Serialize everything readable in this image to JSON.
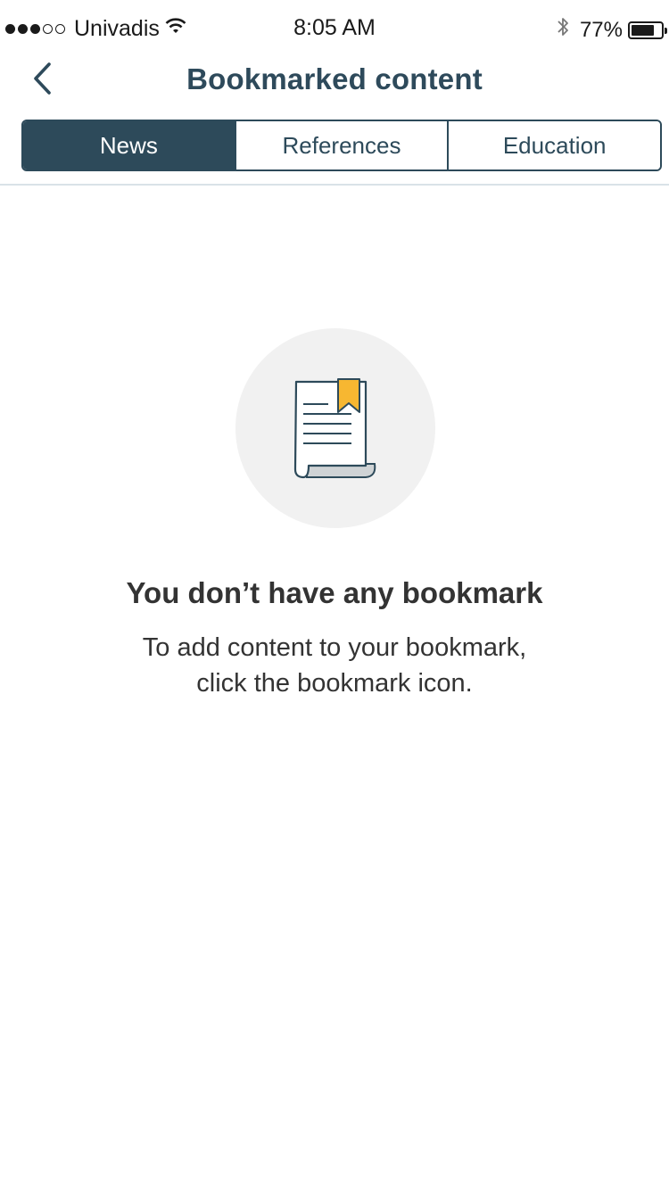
{
  "status_bar": {
    "carrier": "Univadis",
    "time": "8:05 AM",
    "battery_percent": "77%",
    "battery_level": 0.77,
    "signal_icon": "signal-dots-icon",
    "wifi_icon": "wifi-icon",
    "bluetooth_icon": "bluetooth-icon"
  },
  "navbar": {
    "back_icon": "chevron-left-icon",
    "title": "Bookmarked content"
  },
  "tabs": [
    {
      "label": "News",
      "active": true
    },
    {
      "label": "References",
      "active": false
    },
    {
      "label": "Education",
      "active": false
    }
  ],
  "empty_state": {
    "icon": "bookmarked-document-icon",
    "title": "You don’t have any bookmark",
    "line1": "To add content to your bookmark,",
    "line2": "click the bookmark icon."
  },
  "colors": {
    "primary": "#2d4a5a",
    "bookmark_accent": "#f7b731",
    "circle_bg": "#f1f1f1"
  }
}
